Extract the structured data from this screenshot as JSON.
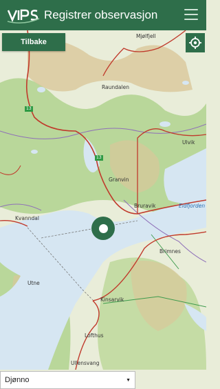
{
  "header": {
    "logo_text": "VIPS",
    "title": "Registrer observasjon",
    "menu_icon": "hamburger-menu-icon"
  },
  "controls": {
    "back_label": "Tilbake",
    "locate_icon": "crosshair-locate-icon"
  },
  "map": {
    "places": [
      {
        "id": "mjolfjell",
        "label": "Mjølfjell"
      },
      {
        "id": "raundalen",
        "label": "Raundalen"
      },
      {
        "id": "ulvik",
        "label": "Ulvik"
      },
      {
        "id": "granvin",
        "label": "Granvin"
      },
      {
        "id": "bruravik",
        "label": "Bruravik"
      },
      {
        "id": "eidfjorden",
        "label": "Eidfjorden"
      },
      {
        "id": "kvanndal",
        "label": "Kvanndal"
      },
      {
        "id": "brimnes",
        "label": "Brimnes"
      },
      {
        "id": "utne",
        "label": "Utne"
      },
      {
        "id": "kinsarvik",
        "label": "Kinsarvik"
      },
      {
        "id": "lofthus",
        "label": "Lofthus"
      },
      {
        "id": "ullensvang",
        "label": "Ullensvang"
      }
    ],
    "road_numbers": [
      "13",
      "13"
    ],
    "colors": {
      "land": "#e9edd9",
      "forest": "#b9d79a",
      "mountain": "#d9c79a",
      "water": "#d6e6f2",
      "road": "#c0392b",
      "boundary": "#8e6fb8"
    }
  },
  "selection": {
    "value": "Djønno"
  }
}
